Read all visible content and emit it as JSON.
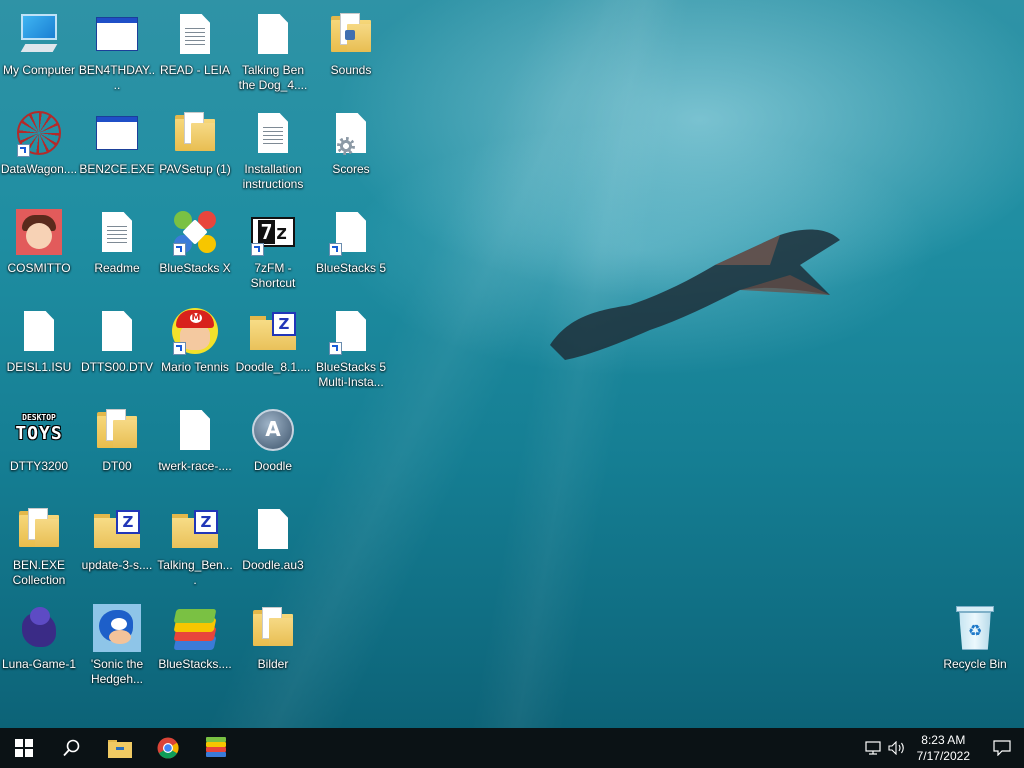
{
  "desktop": {
    "icons": [
      {
        "label": "My Computer"
      },
      {
        "label": "BEN4THDAY...."
      },
      {
        "label": "READ - LEIA"
      },
      {
        "label": "Talking Ben\nthe Dog_4...."
      },
      {
        "label": "Sounds"
      },
      {
        "label": "DataWagon...."
      },
      {
        "label": "BEN2CE.EXE"
      },
      {
        "label": "PAVSetup (1)"
      },
      {
        "label": "Installation\ninstructions"
      },
      {
        "label": "Scores"
      },
      {
        "label": "COSMITTO"
      },
      {
        "label": "Readme"
      },
      {
        "label": "BlueStacks X"
      },
      {
        "label": "7zFM -\nShortcut"
      },
      {
        "label": "BlueStacks 5"
      },
      {
        "label": "DEISL1.ISU"
      },
      {
        "label": "DTTS00.DTV"
      },
      {
        "label": "Mario Tennis"
      },
      {
        "label": "Doodle_8.1...."
      },
      {
        "label": "BlueStacks 5\nMulti-Insta..."
      },
      {
        "label": "DTTY3200"
      },
      {
        "label": "DT00"
      },
      {
        "label": "twerk-race-...."
      },
      {
        "label": "Doodle"
      },
      {
        "label": "BEN.EXE\nCollection"
      },
      {
        "label": "update-3-s...."
      },
      {
        "label": "Talking_Ben...."
      },
      {
        "label": "Doodle.au3"
      },
      {
        "label": "Luna-Game-1"
      },
      {
        "label": "'Sonic the\nHedgeh..."
      },
      {
        "label": "BlueStacks...."
      },
      {
        "label": "Bilder"
      },
      {
        "label": "Recycle Bin"
      }
    ],
    "desktop_toys_text": {
      "top": "DESKTOP",
      "bottom": "TOYS"
    },
    "zip_badge": "Z",
    "sevenzip_text": {
      "seven": "7",
      "z": "z"
    }
  },
  "taskbar": {
    "icons": [
      "windows-start-icon",
      "search-icon",
      "file-explorer-icon",
      "chrome-icon",
      "bluestacks-icon"
    ],
    "clock": {
      "time": "8:23 AM",
      "date": "7/17/2022"
    },
    "tray_icons": [
      "network-icon",
      "volume-icon",
      "notification-icon"
    ]
  },
  "colors": {
    "wallpaper_top": "#2f93a6",
    "wallpaper_bottom": "#0b5e72",
    "taskbar": "#0b1215",
    "folder": "#f0ca63",
    "bluestacks_green": "#7ac143",
    "bluestacks_yellow": "#f7c600",
    "bluestacks_red": "#e8453c",
    "bluestacks_blue": "#3b7bd8"
  }
}
